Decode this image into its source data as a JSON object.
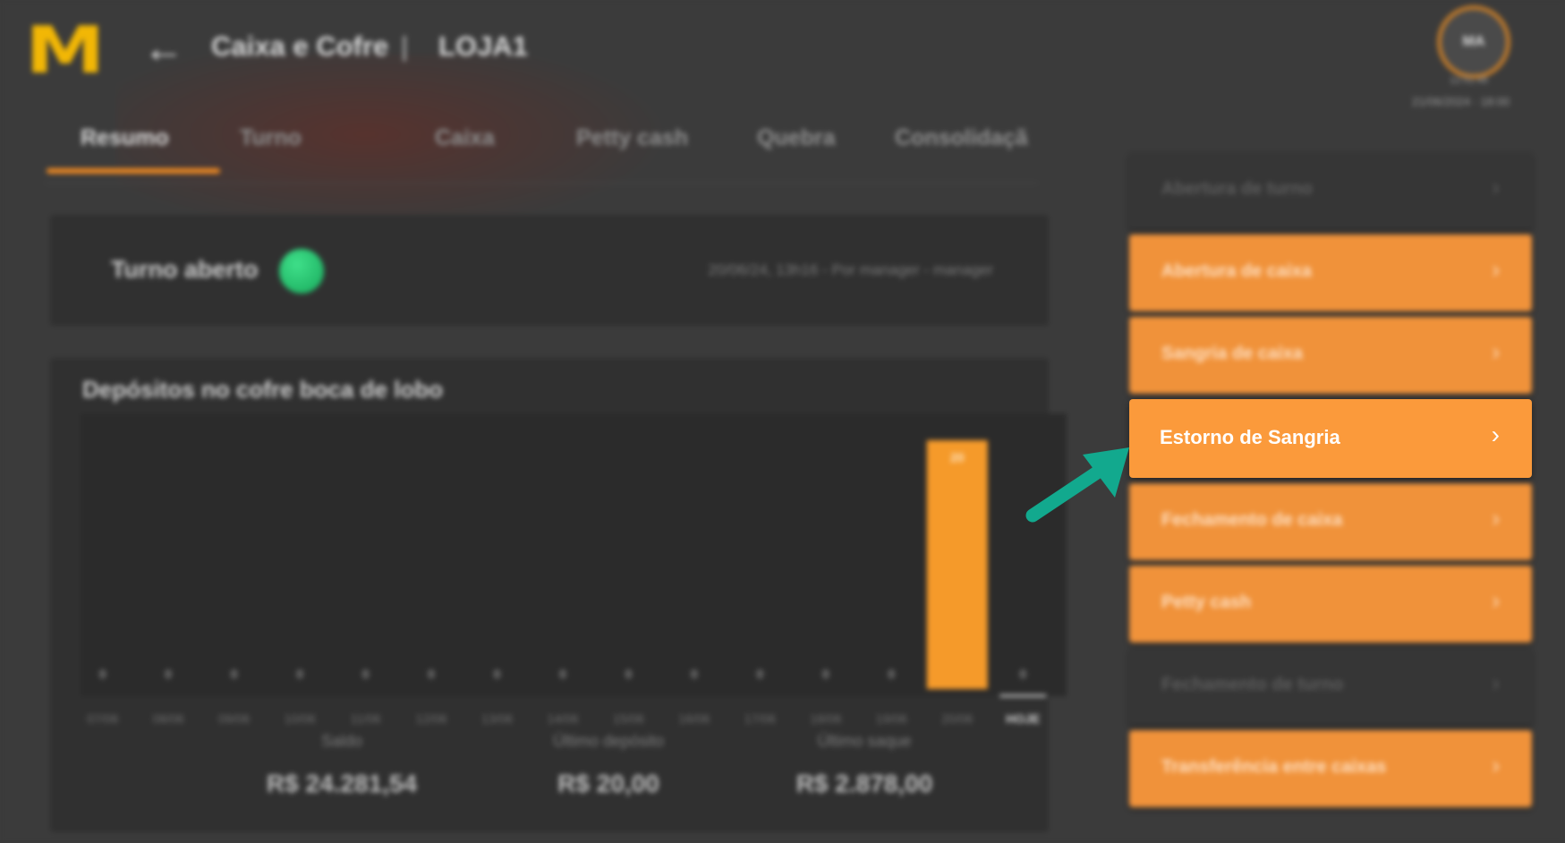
{
  "header": {
    "logo": "M",
    "back_icon": "arrow-left-icon",
    "title": "Caixa e Cofre",
    "separator": "|",
    "store": "LOJA1",
    "avatar_initials": "MA",
    "user_time": "12:51:48",
    "user_date": "21/06/2024 · 18:00"
  },
  "tabs": [
    {
      "label": "Resumo",
      "active": true
    },
    {
      "label": "Turno"
    },
    {
      "label": "Caixa"
    },
    {
      "label": "Petty cash"
    },
    {
      "label": "Quebra"
    },
    {
      "label": "Consolidaçã"
    }
  ],
  "shift": {
    "label": "Turno aberto",
    "status_color": "#1fbf6a",
    "meta": "20/06/24, 13h16 - Por manager - manager"
  },
  "chart_card": {
    "title": "Depósitos no cofre boca de lobo",
    "stats": [
      {
        "label": "Saldo",
        "value": "R$ 24.281,54"
      },
      {
        "label": "Último depósito",
        "value": "R$ 20,00"
      },
      {
        "label": "Último saque",
        "value": "R$ 2.878,00"
      }
    ]
  },
  "chart_data": {
    "type": "bar",
    "title": "Depósitos no cofre boca de lobo",
    "categories": [
      "07/06",
      "08/06",
      "09/06",
      "10/06",
      "11/06",
      "12/06",
      "13/06",
      "14/06",
      "15/06",
      "16/06",
      "17/06",
      "18/06",
      "19/06",
      "20/06",
      "HOJE"
    ],
    "values": [
      0,
      0,
      0,
      0,
      0,
      0,
      0,
      0,
      0,
      0,
      0,
      0,
      0,
      20,
      0
    ],
    "value_labels": [
      "0",
      "0",
      "0",
      "0",
      "0",
      "0",
      "0",
      "0",
      "0",
      "0",
      "0",
      "0",
      "0",
      "20",
      "0"
    ],
    "highlight_category": "HOJE",
    "bar_color": "#f59a2a",
    "grid": false
  },
  "sidebar": {
    "items": [
      {
        "label": "Abertura de turno",
        "style": "disabled"
      },
      {
        "label": "Abertura de caixa",
        "style": "orange"
      },
      {
        "label": "Sangria de caixa",
        "style": "orange"
      },
      {
        "label": "Estorno de Sangria",
        "style": "focus"
      },
      {
        "label": "Fechamento de caixa",
        "style": "orange"
      },
      {
        "label": "Petty cash",
        "style": "orange"
      },
      {
        "label": "Fechamento de turno",
        "style": "disabled"
      },
      {
        "label": "Transferência entre caixas",
        "style": "orange"
      }
    ],
    "chevron_icon": "chevron-right-icon"
  },
  "annotation": {
    "pointer_icon": "arrow-pointer-icon",
    "pointer_color": "#12a98e"
  }
}
